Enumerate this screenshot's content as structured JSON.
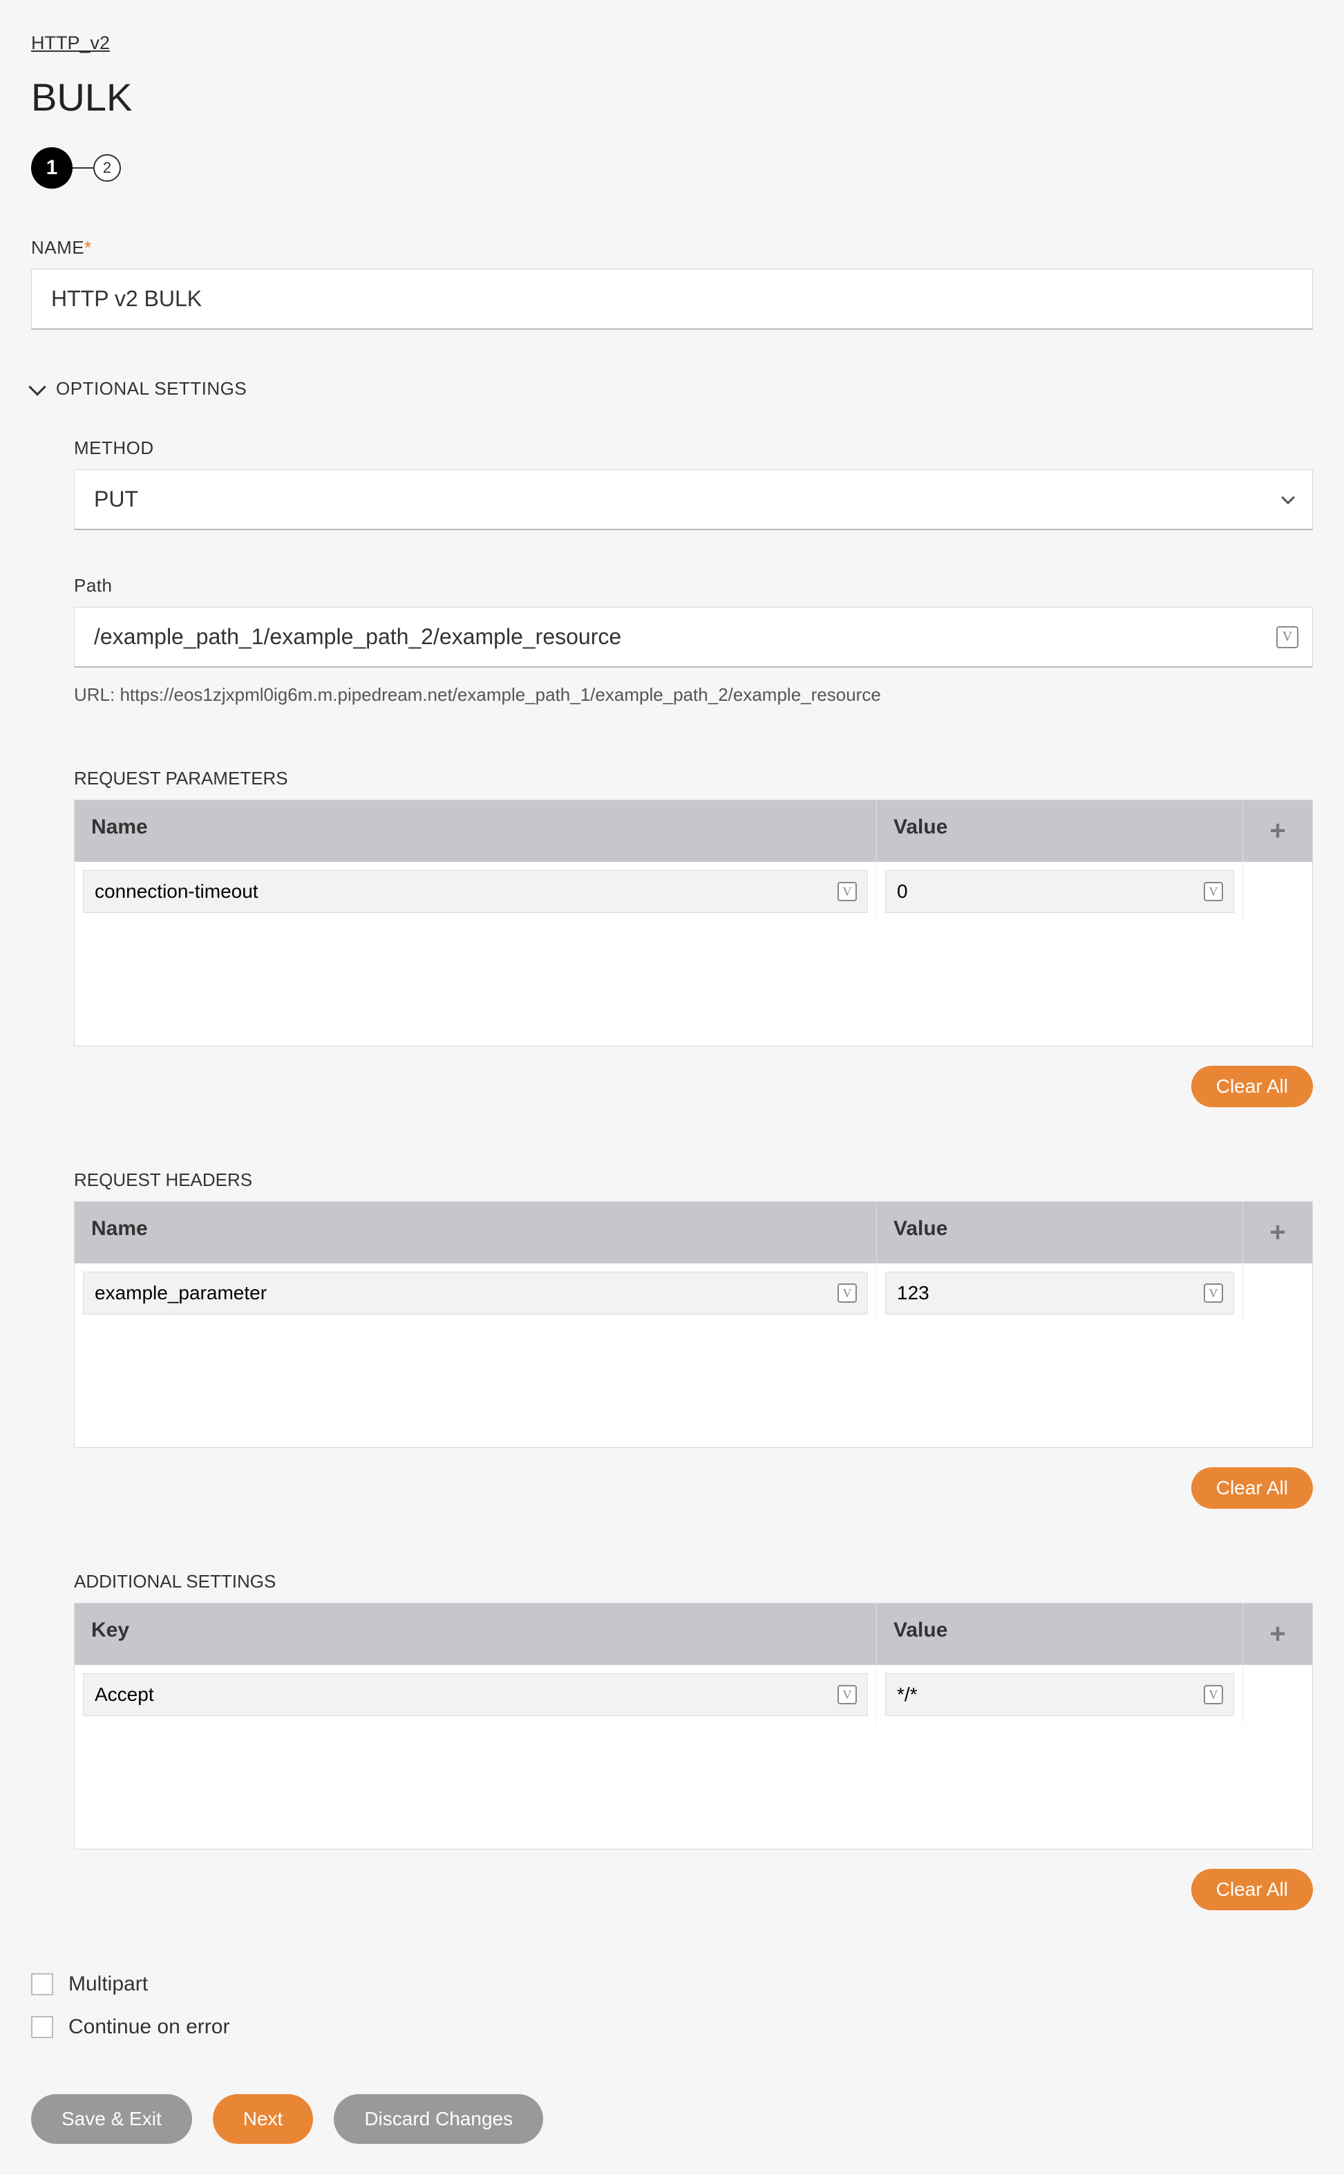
{
  "breadcrumb": "HTTP_v2",
  "title": "BULK",
  "stepper": {
    "step1": "1",
    "step2": "2"
  },
  "name": {
    "label": "NAME",
    "value": "HTTP v2 BULK"
  },
  "optional": {
    "header": "OPTIONAL SETTINGS",
    "method": {
      "label": "METHOD",
      "value": "PUT"
    },
    "path": {
      "label": "Path",
      "value": "/example_path_1/example_path_2/example_resource",
      "url_prefix": "URL: ",
      "url": "https://eos1zjxpml0ig6m.m.pipedream.net/example_path_1/example_path_2/example_resource"
    },
    "tables": {
      "params": {
        "label": "REQUEST PARAMETERS",
        "col_name": "Name",
        "col_value": "Value",
        "row": {
          "name": "connection-timeout",
          "value": "0"
        },
        "clear": "Clear All"
      },
      "headers": {
        "label": "REQUEST HEADERS",
        "col_name": "Name",
        "col_value": "Value",
        "row": {
          "name": "example_parameter",
          "value": "123"
        },
        "clear": "Clear All"
      },
      "additional": {
        "label": "ADDITIONAL SETTINGS",
        "col_name": "Key",
        "col_value": "Value",
        "row": {
          "name": "Accept",
          "value": "*/*"
        },
        "clear": "Clear All"
      }
    },
    "multipart": "Multipart",
    "continue_on_error": "Continue on error"
  },
  "buttons": {
    "save_exit": "Save & Exit",
    "next": "Next",
    "discard": "Discard Changes"
  },
  "v_glyph": "V",
  "plus": "+"
}
